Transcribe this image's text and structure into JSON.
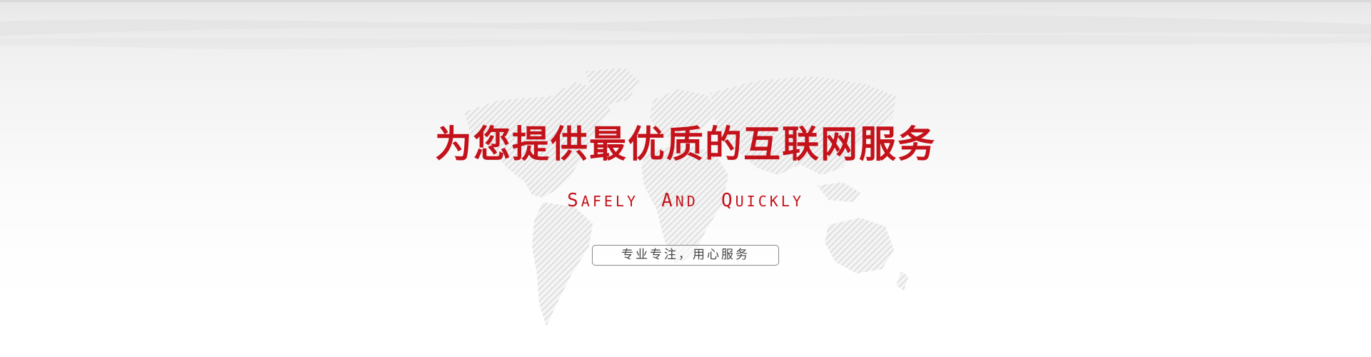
{
  "banner": {
    "headline": "为您提供最优质的互联网服务",
    "tagline": {
      "words": [
        {
          "initial": "S",
          "rest": "AFELY"
        },
        {
          "initial": "A",
          "rest": "ND"
        },
        {
          "initial": "Q",
          "rest": "UICKLY"
        }
      ]
    },
    "cta_label": "专业专注，用心服务",
    "background_icon": "world-map-icon",
    "colors": {
      "accent": "#c4121b",
      "button_text": "#444444",
      "button_border": "#888888",
      "map_stripe": "#d2d2d2"
    }
  }
}
